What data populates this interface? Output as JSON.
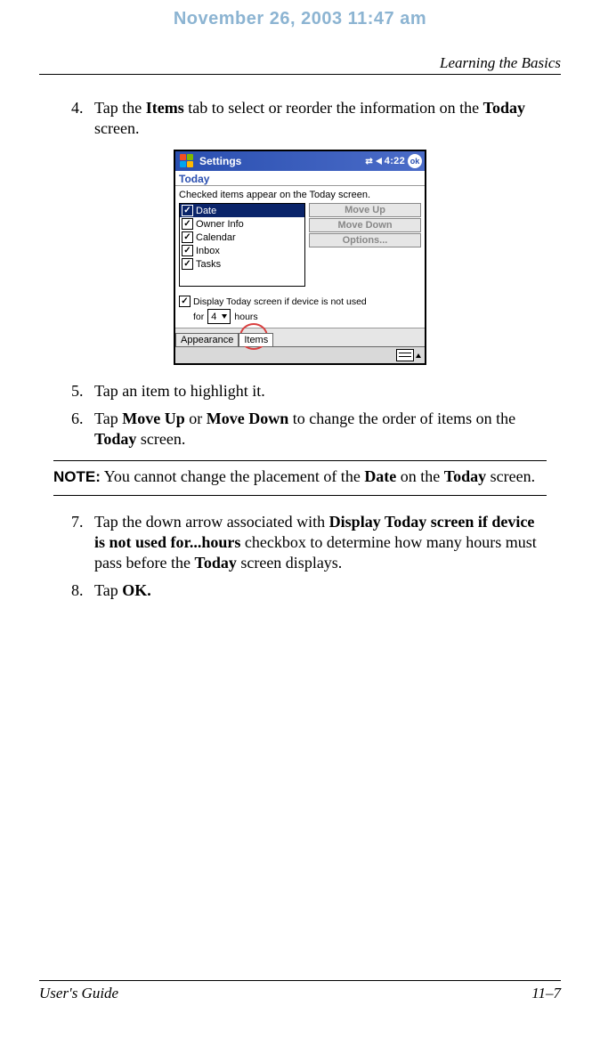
{
  "timestamp": "November 26, 2003 11:47 am",
  "header_section": "Learning the Basics",
  "steps": {
    "s4_a": "Tap the ",
    "s4_b": "Items",
    "s4_c": " tab to select or reorder the information on the ",
    "s4_d": "Today",
    "s4_e": " screen.",
    "s5": "Tap an item to highlight it.",
    "s6_a": "Tap ",
    "s6_b": "Move Up",
    "s6_c": " or ",
    "s6_d": "Move Down",
    "s6_e": " to change the order of items on the ",
    "s6_f": "Today",
    "s6_g": " screen.",
    "s7_a": "Tap the down arrow associated with ",
    "s7_b": "Display Today screen if device is not used for...hours",
    "s7_c": " checkbox to determine how many hours must pass before the ",
    "s7_d": "Today",
    "s7_e": " screen displays.",
    "s8_a": "Tap ",
    "s8_b": "OK."
  },
  "note": {
    "label": "NOTE:",
    "a": " You cannot change the placement of the ",
    "b": "Date",
    "c": " on the ",
    "d": "Today",
    "e": " screen."
  },
  "device": {
    "title": "Settings",
    "time": "4:22",
    "ok": "ok",
    "subtitle": "Today",
    "instruction": "Checked items appear on the Today screen.",
    "items": [
      "Date",
      "Owner Info",
      "Calendar",
      "Inbox",
      "Tasks"
    ],
    "buttons": {
      "up": "Move Up",
      "down": "Move Down",
      "options": "Options..."
    },
    "display_label": "Display Today screen if device is not used",
    "for": "for",
    "hours_value": "4",
    "hours_label": "hours",
    "tabs": {
      "appearance": "Appearance",
      "items": "Items"
    }
  },
  "footer": {
    "left": "User's Guide",
    "right": "11–7"
  }
}
